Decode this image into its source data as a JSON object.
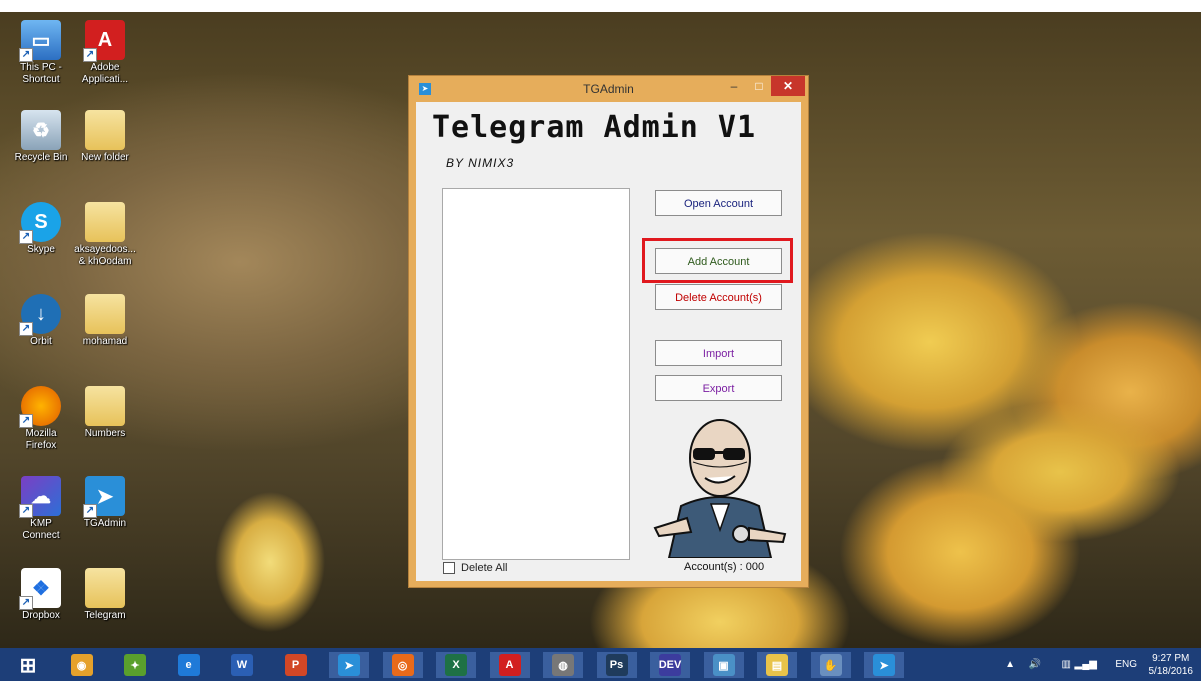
{
  "desktop": {
    "icons": [
      {
        "label": "This PC -\nShortcut",
        "icon": "computer-icon"
      },
      {
        "label": "Adobe\nApplicati...",
        "icon": "adobe-icon"
      },
      {
        "label": "Recycle Bin",
        "icon": "recycle-bin-icon"
      },
      {
        "label": "New folder",
        "icon": "folder-icon"
      },
      {
        "label": "Skype",
        "icon": "skype-icon"
      },
      {
        "label": "aksayedoos...\n& khOodam",
        "icon": "folder-icon"
      },
      {
        "label": "Orbit",
        "icon": "orbit-icon"
      },
      {
        "label": "mohamad",
        "icon": "folder-icon"
      },
      {
        "label": "Mozilla\nFirefox",
        "icon": "firefox-icon"
      },
      {
        "label": "Numbers",
        "icon": "folder-icon"
      },
      {
        "label": "KMP\nConnect",
        "icon": "kmp-icon"
      },
      {
        "label": "TGAdmin",
        "icon": "telegram-icon"
      },
      {
        "label": "Dropbox",
        "icon": "dropbox-icon"
      },
      {
        "label": "Telegram",
        "icon": "folder-icon"
      }
    ]
  },
  "window": {
    "title": "TGAdmin",
    "minimize": "–",
    "maximize": "□",
    "close": "✕",
    "app_title": "Telegram Admin V1",
    "byline": "BY NIMIX3",
    "buttons": {
      "open_account": "Open Account",
      "add_account": "Add Account",
      "delete_accounts": "Delete Account(s)",
      "import": "Import",
      "export": "Export"
    },
    "colors": {
      "open": "#1a237e",
      "add": "#2e5a1c",
      "delete": "#c00000",
      "import": "#7b1fa2",
      "export": "#7b1fa2",
      "highlight": "#e0181e"
    },
    "delete_all_label": "Delete All",
    "account_count": "Account(s) : 000"
  },
  "taskbar": {
    "apps": [
      {
        "name": "start-icon",
        "glyph": "⊞"
      },
      {
        "name": "chrome-icon",
        "glyph": "◉"
      },
      {
        "name": "network-icon",
        "glyph": "✦"
      },
      {
        "name": "edge-icon",
        "glyph": "e"
      },
      {
        "name": "word-icon",
        "glyph": "W"
      },
      {
        "name": "powerpoint-icon",
        "glyph": "P"
      },
      {
        "name": "telegram-icon",
        "glyph": "➤"
      },
      {
        "name": "firefox-icon",
        "glyph": "◎"
      },
      {
        "name": "excel-icon",
        "glyph": "X"
      },
      {
        "name": "acrobat-icon",
        "glyph": "A"
      },
      {
        "name": "media-icon",
        "glyph": "◍"
      },
      {
        "name": "photoshop-icon",
        "glyph": "Ps"
      },
      {
        "name": "dev-icon",
        "glyph": "DEV"
      },
      {
        "name": "photos-icon",
        "glyph": "▣"
      },
      {
        "name": "explorer-icon",
        "glyph": "▤"
      },
      {
        "name": "hand-icon",
        "glyph": "✋"
      },
      {
        "name": "tgadmin-icon",
        "glyph": "➤"
      }
    ],
    "tray": {
      "language": "ENG",
      "time": "9:27 PM",
      "date": "5/18/2016"
    }
  }
}
